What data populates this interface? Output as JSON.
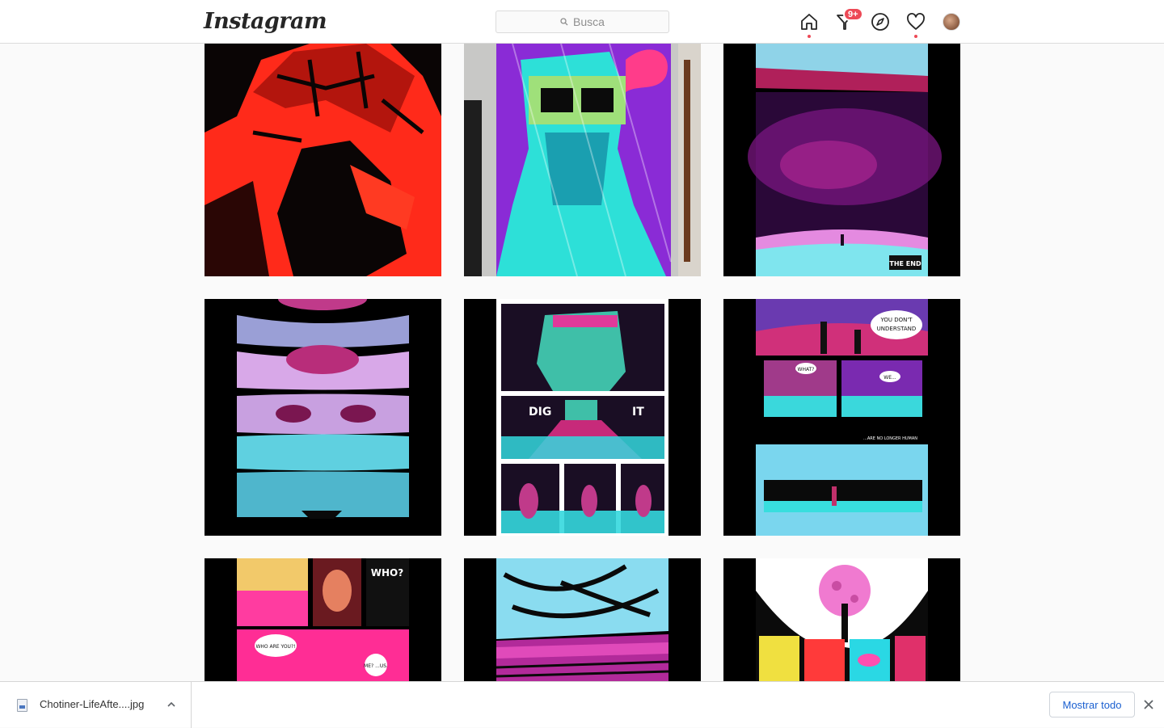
{
  "header": {
    "logo": "Instagram",
    "search_placeholder": "Busca",
    "notifications_badge": "9+",
    "icons": [
      "home-icon",
      "direct-icon",
      "explore-icon",
      "activity-icon",
      "profile-avatar"
    ]
  },
  "colors": {
    "accent_red": "#ed4956",
    "link_blue": "#1a5fd0",
    "border": "#dbdbdb"
  },
  "posts": [
    {
      "row": 1,
      "col": 1,
      "caption": ""
    },
    {
      "row": 1,
      "col": 2,
      "caption": ""
    },
    {
      "row": 1,
      "col": 3,
      "caption": "THE END"
    },
    {
      "row": 2,
      "col": 1,
      "caption": ""
    },
    {
      "row": 2,
      "col": 2,
      "caption": "DIG IT"
    },
    {
      "row": 2,
      "col": 3,
      "caption": "YOU DON'T UNDERSTAND"
    },
    {
      "row": 3,
      "col": 1,
      "caption": "WHO?"
    },
    {
      "row": 3,
      "col": 2,
      "caption": ""
    },
    {
      "row": 3,
      "col": 3,
      "caption": ""
    }
  ],
  "comic_text": {
    "dig": "DIG",
    "it": "IT",
    "you_dont": "YOU DON'T",
    "understand": "UNDERSTAND",
    "what": "WHAT?",
    "we": "WE...",
    "no_longer": "...ARE NO LONGER HUMAN",
    "who": "WHO?",
    "who_are_you": "WHO ARE YOU?!",
    "me_us": "ME? ...US.",
    "the_end": "THE END"
  },
  "downloads": {
    "file_name": "Chotiner-LifeAfte....jpg",
    "show_all_label": "Mostrar todo"
  }
}
